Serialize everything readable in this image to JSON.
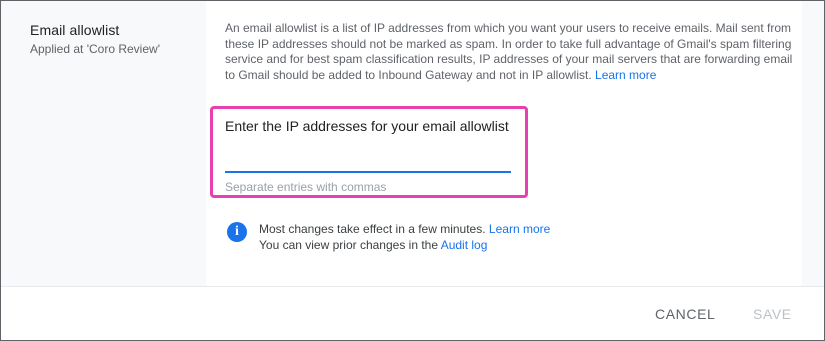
{
  "setting": {
    "title": "Email allowlist",
    "applied_at": "Applied at 'Coro Review'"
  },
  "description": {
    "text": "An email allowlist is a list of IP addresses from which you want your users to receive emails. Mail sent from these IP addresses should not be marked as spam. In order to take full advantage of Gmail's spam filtering service and for best spam classification results, IP addresses of your mail servers that are forwarding email to Gmail should be added to Inbound Gateway and not in IP allowlist.",
    "learn_more": "Learn more"
  },
  "allowlist_field": {
    "label": "Enter the IP addresses for your email allowlist",
    "value": "",
    "hint": "Separate entries with commas"
  },
  "info": {
    "icon": "info-icon",
    "line1_text": "Most changes take effect in a few minutes.",
    "line1_link": "Learn more",
    "line2_text": "You can view prior changes in the",
    "line2_link": "Audit log"
  },
  "footer": {
    "cancel_label": "CANCEL",
    "save_label": "SAVE"
  },
  "colors": {
    "accent": "#1a73e8",
    "highlight": "#e840b0"
  }
}
